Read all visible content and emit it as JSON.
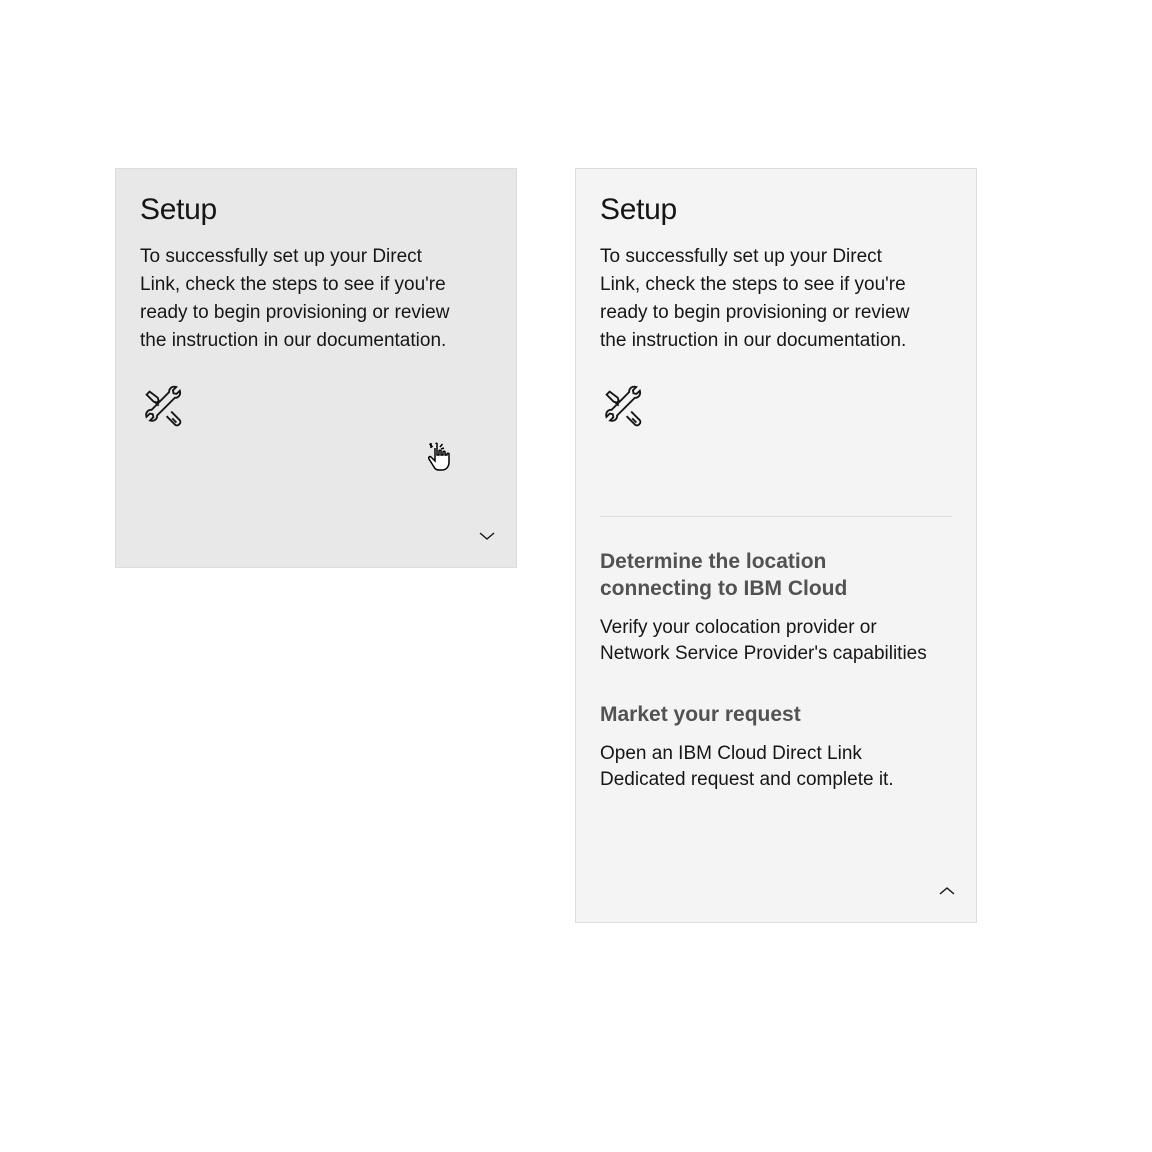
{
  "cards": {
    "collapsed": {
      "title": "Setup",
      "description": "To successfully set up your Direct Link, check the steps to see if you're ready to begin provisioning or review the instruction in our documentation."
    },
    "expanded": {
      "title": "Setup",
      "description": "To successfully set up your Direct Link, check the steps to see if you're ready to begin provisioning or review the instruction in our documentation.",
      "steps": [
        {
          "title": "Determine the location connecting to IBM Cloud",
          "description": "Verify your colocation provider or Network Service Provider's capabilities"
        },
        {
          "title": "Market your request",
          "description": "Open an IBM Cloud Direct Link Dedicated request and complete it."
        }
      ]
    }
  }
}
